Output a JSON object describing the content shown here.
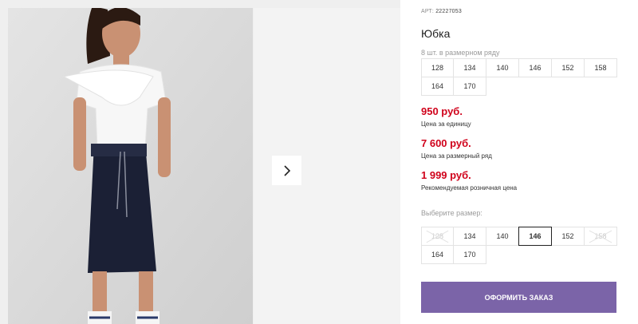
{
  "product": {
    "article_label": "АРТ:",
    "article": "22227053",
    "title": "Юбка"
  },
  "set_info": "8 шт. в размерном ряду",
  "size_row": [
    "128",
    "134",
    "140",
    "146",
    "152",
    "158",
    "164",
    "170"
  ],
  "prices": [
    {
      "value": "950 руб.",
      "label": "Цена за единицу"
    },
    {
      "value": "7 600 руб.",
      "label": "Цена за размерный ряд"
    },
    {
      "value": "1 999 руб.",
      "label": "Рекомендуемая розничная цена"
    }
  ],
  "size_select": {
    "label": "Выберите размер:",
    "options": [
      "128",
      "134",
      "140",
      "146",
      "152",
      "158",
      "164",
      "170"
    ],
    "disabled": [
      "128",
      "158"
    ],
    "selected": "146"
  },
  "order_button": "ОФОРМИТЬ ЗАКАЗ",
  "colors": {
    "price": "#d0021b",
    "button": "#7b64a8"
  },
  "icons": {
    "next": "chevron-right-icon"
  }
}
